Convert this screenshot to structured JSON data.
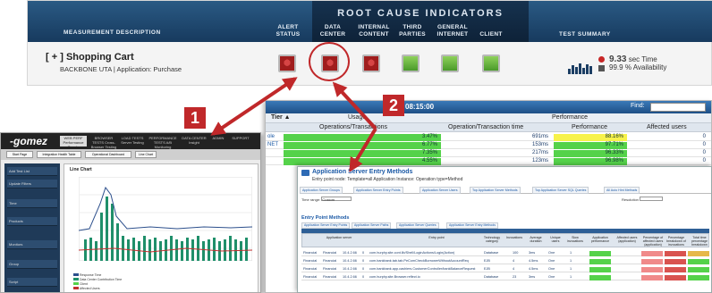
{
  "header": {
    "measurement_label": "MEASUREMENT DESCRIPTION",
    "alert_status": "ALERT STATUS",
    "rci_title": "ROOT CAUSE INDICATORS",
    "columns": [
      "DATA CENTER",
      "INTERNAL CONTENT",
      "THIRD PARTIES",
      "GENERAL INTERNET",
      "CLIENT"
    ],
    "test_summary": "TEST SUMMARY"
  },
  "row": {
    "toggle": "[ + ]",
    "name": "Shopping Cart",
    "subtitle": "BACKBONE UTA  |  Application: Purchase",
    "alert": "red",
    "indicators": [
      "red",
      "red",
      "green",
      "green",
      "green"
    ],
    "time_value": "9.33",
    "time_unit": "sec Time",
    "avail_value": "99.9",
    "avail_unit": "% Availability"
  },
  "callouts": [
    "1",
    "2"
  ],
  "colors": {
    "header": "#1f4a72",
    "red": "#c0282a",
    "green": "#55d24a",
    "yellow": "#f7f24a"
  },
  "gomez": {
    "logo": "-gomez",
    "tabs": [
      "WEB PERF Performance Trends",
      "BROWSER TESTS Cross-Browser Testing",
      "LOAD TESTS Server Testing",
      "PERFORMANCE TESTS A/B Monitoring",
      "DATA CENTER Insight",
      "ADMIN",
      "SUPPORT"
    ],
    "buttons": [
      "Start Page",
      "Integration Health Table",
      "Operational Dashboard",
      "Line Chart"
    ],
    "side_items": [
      "Add Test List",
      "Update Filters",
      "Time",
      "Products",
      "Monitors",
      "Group",
      "Script"
    ],
    "chart_title": "Line Chart",
    "legend": [
      "Response Time",
      "Data Center Contribution Time",
      "Client",
      "Affected Users"
    ]
  },
  "perf": {
    "time": "08:15:00",
    "find": "Find:",
    "col_tier": "Tier ▲",
    "col_usage": "Usage",
    "col_ops": "Operations/Transactions",
    "col_performance": "Performance",
    "col_resp": "Operation/Transaction time",
    "col_perf": "Performance",
    "col_affected": "Affected users",
    "rows": [
      {
        "name": "ole",
        "usage": "3.47%",
        "resp": "691ms",
        "perf": "88.16%",
        "perf_color": "yellow",
        "aff": "0"
      },
      {
        "name": "NET",
        "usage": "6.77%",
        "resp": "153ms",
        "perf": "97.71%",
        "perf_color": "green",
        "aff": "0"
      },
      {
        "name": "",
        "usage": "7.35%",
        "resp": "217ms",
        "perf": "96.33%",
        "perf_color": "green",
        "aff": "0"
      },
      {
        "name": "",
        "usage": "4.55%",
        "resp": "123ms",
        "perf": "96.98%",
        "perf_color": "green",
        "aff": "0"
      }
    ]
  },
  "asem": {
    "title": "Application Server Entry Methods",
    "subtitle": "Entry point node: Template=all  Application Instance: Operation type=Method",
    "tabs": [
      "Application Server Groups",
      "Application Server Entry Points",
      "Application Server Users",
      "Top Application Server Methods",
      "Top Application Server SQL Queries",
      "All Auto Hint Methods"
    ],
    "timerange_label": "Time range:",
    "timerange_value": "Custom",
    "resolution_label": "Resolution",
    "entry_points_label": "Entry Point Methods",
    "entry_tabs": [
      "Application Server Entry Points",
      "Application Server Paths",
      "Application Server Queries",
      "Application Server Entry Methods"
    ],
    "headers": [
      "Application server",
      "Entry point",
      "Technology category",
      "Invocations",
      "Average duration",
      "Unique users",
      "Slow invocations",
      "Application performance",
      "Affected users (application)",
      "Percentage of affected users (application)",
      "Percentage breakdown of invocations",
      "Total time percentage breakdown"
    ],
    "rows": [
      {
        "group": "Financial",
        "node": "Financial",
        "ip": "10.4.2.66",
        "port": "0",
        "entry": "com.hurphy.site.cont.lib/Shell/LoginActions/Login(Action)",
        "tech": "Database",
        "inv": "100",
        "dur": "3ms",
        "users": "One",
        "slow": "1"
      },
      {
        "group": "Financial",
        "node": "Financial",
        "ip": "10.4.2.66",
        "port": "0",
        "entry": "com.bankbank.tab.tab.PeComCheckBorrowerWithoutAccountReq",
        "tech": "EJB",
        "inv": "4",
        "dur": "4.5ms",
        "users": "One",
        "slow": "1"
      },
      {
        "group": "Financial",
        "node": "Financial",
        "ip": "10.4.2.66",
        "port": "0",
        "entry": "com.bankbank.app.cashiers.CustomerController/bankBalanceRequest",
        "tech": "EJB",
        "inv": "4",
        "dur": "4.5ms",
        "users": "One",
        "slow": "1"
      },
      {
        "group": "Financial",
        "node": "Financial",
        "ip": "10.4.2.66",
        "port": "0",
        "entry": "com.hurphy.site.Browser.reflect.io",
        "tech": "Database",
        "inv": "23",
        "dur": "3ms",
        "users": "One",
        "slow": "1"
      }
    ]
  }
}
